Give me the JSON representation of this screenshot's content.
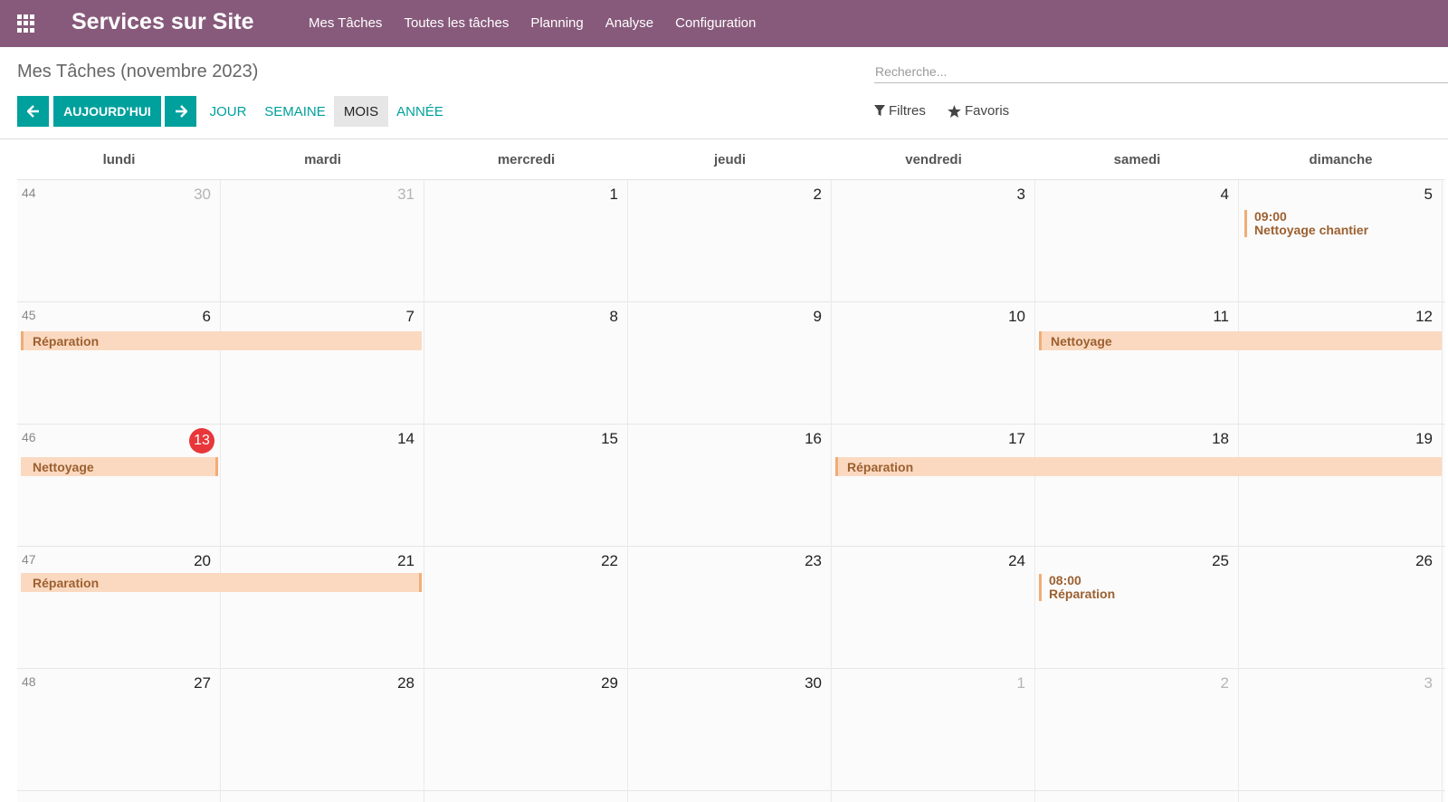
{
  "navbar": {
    "app_title": "Services sur Site",
    "menu": [
      "Mes Tâches",
      "Toutes les tâches",
      "Planning",
      "Analyse",
      "Configuration"
    ]
  },
  "control_panel": {
    "breadcrumb": "Mes Tâches (novembre 2023)",
    "search_placeholder": "Recherche...",
    "today_label": "AUJOURD'HUI",
    "scales": [
      "JOUR",
      "SEMAINE",
      "MOIS",
      "ANNÉE"
    ],
    "active_scale": "MOIS",
    "filters_label": "Filtres",
    "favorites_label": "Favoris"
  },
  "calendar": {
    "weekdays": [
      "lundi",
      "mardi",
      "mercredi",
      "jeudi",
      "vendredi",
      "samedi",
      "dimanche"
    ],
    "today": "13",
    "weeks": [
      {
        "week": "44",
        "days": [
          "30",
          "31",
          "1",
          "2",
          "3",
          "4",
          "5"
        ]
      },
      {
        "week": "45",
        "days": [
          "6",
          "7",
          "8",
          "9",
          "10",
          "11",
          "12"
        ]
      },
      {
        "week": "46",
        "days": [
          "13",
          "14",
          "15",
          "16",
          "17",
          "18",
          "19"
        ]
      },
      {
        "week": "47",
        "days": [
          "20",
          "21",
          "22",
          "23",
          "24",
          "25",
          "26"
        ]
      },
      {
        "week": "48",
        "days": [
          "27",
          "28",
          "29",
          "30",
          "1",
          "2",
          "3"
        ]
      }
    ],
    "events": {
      "nettoyage_chantier": {
        "time": "09:00",
        "title": "Nettoyage chantier"
      },
      "reparation_w45": {
        "title": "Réparation"
      },
      "nettoyage_w45": {
        "title": "Nettoyage"
      },
      "nettoyage_w46": {
        "title": "Nettoyage"
      },
      "reparation_w46": {
        "title": "Réparation"
      },
      "reparation_w47": {
        "title": "Réparation"
      },
      "reparation_timed": {
        "time": "08:00",
        "title": "Réparation"
      }
    }
  },
  "colors": {
    "navbar": "#875a7b",
    "primary": "#00a09d",
    "event_bg": "#fbd9c0",
    "event_text": "#9c6030",
    "today_badge": "#e8363a"
  }
}
